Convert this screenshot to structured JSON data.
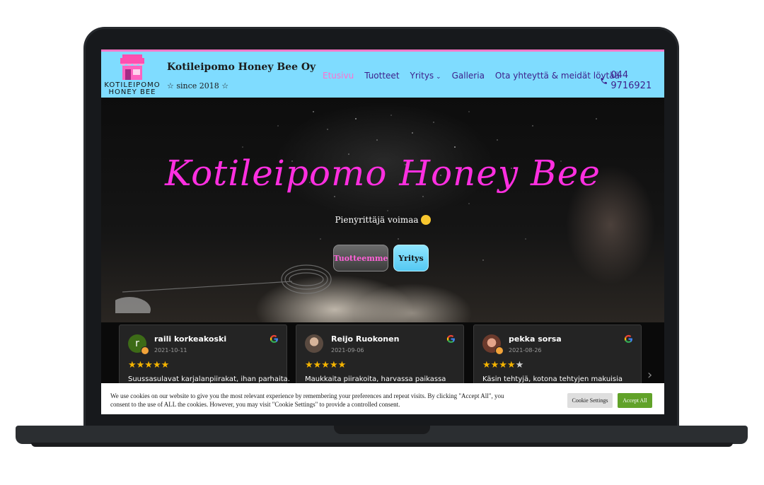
{
  "header": {
    "logo_text_line1": "KOTILEIPOMO",
    "logo_text_line2": "HONEY BEE",
    "site_title": "Kotileipomo Honey Bee Oy",
    "tagline": "☆ since 2018 ☆",
    "nav": {
      "home": "Etusivu",
      "products": "Tuotteet",
      "company": "Yritys",
      "gallery": "Galleria",
      "contact": "Ota yhteyttä & meidät löytää"
    },
    "phone": "044 9716921"
  },
  "hero": {
    "title": "Kotileipomo Honey Bee",
    "subtitle": "Pienyrittäjä voimaa",
    "btn_products": "Tuotteemme",
    "btn_company": "Yritys"
  },
  "reviews": [
    {
      "name": "raili korkeakoski",
      "initial": "r",
      "date": "2021-10-11",
      "rating": 5,
      "text": "Suussasulavat karjalanpiirakat, ihan parhaita."
    },
    {
      "name": "Reijo Ruokonen",
      "initial": "",
      "date": "2021-09-06",
      "rating": 5,
      "text": "Maukkaita piirakoita, harvassa paikassa"
    },
    {
      "name": "pekka sorsa",
      "initial": "",
      "date": "2021-08-26",
      "rating": 4,
      "text": "Käsin tehtyjä, kotona tehtyjen makuisia"
    }
  ],
  "cookie": {
    "text": "We use cookies on our website to give you the most relevant experience by remembering your preferences and repeat visits. By clicking \"Accept All\", you consent to the use of ALL the cookies. However, you may visit \"Cookie Settings\" to provide a controlled consent.",
    "settings_label": "Cookie Settings",
    "accept_label": "Accept All"
  },
  "colors": {
    "header_bg": "#7fdcff",
    "hero_title": "#ff2fe0",
    "nav_text": "#3d1f8a",
    "nav_active": "#ff6fd0",
    "star": "#f5b400",
    "accept": "#61a229"
  },
  "icons": [
    "shop-logo-icon",
    "chevron-down-icon",
    "phone-icon",
    "wink-emoji-icon",
    "google-icon",
    "chevron-right-icon"
  ]
}
